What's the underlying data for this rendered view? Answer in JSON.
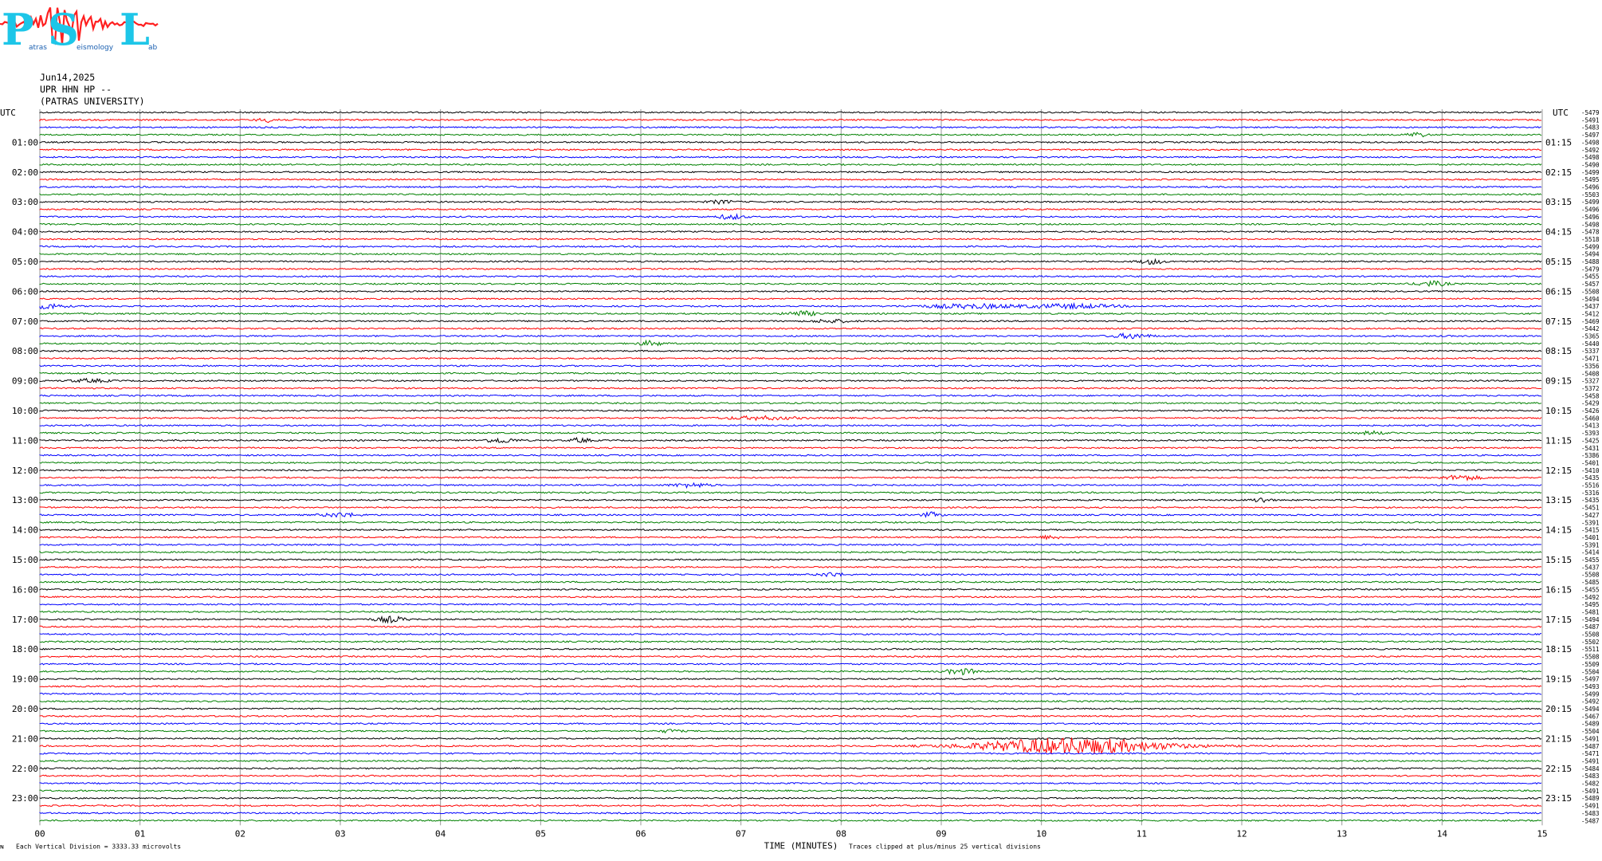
{
  "logo": {
    "letters": [
      "P",
      "S",
      "L"
    ],
    "words": [
      "atras",
      "eismology",
      "ab"
    ],
    "colors": {
      "letters": "#1dc6e8",
      "wave": "#ff2020",
      "words": "#1a5fb0"
    }
  },
  "header": {
    "date": "Jun14,2025",
    "station": "UPR HHN HP --",
    "institution": "(PATRAS UNIVERSITY)"
  },
  "footer": {
    "left_mark": "ɴ",
    "division_note": "Each Vertical Division = 3333.33 microvolts",
    "clip_note": "Traces clipped at plus/minus 25 vertical divisions"
  },
  "chart_data": {
    "type": "line",
    "title": "",
    "xlabel": "TIME (MINUTES)",
    "x_ticks": [
      "00",
      "01",
      "02",
      "03",
      "04",
      "05",
      "06",
      "07",
      "08",
      "09",
      "10",
      "11",
      "12",
      "13",
      "14",
      "15"
    ],
    "xlim": [
      0,
      15
    ],
    "left_axis_title": "UTC",
    "right_axis_title": "UTC",
    "left_hour_labels": [
      "01:00",
      "02:00",
      "03:00",
      "04:00",
      "05:00",
      "06:00",
      "07:00",
      "08:00",
      "09:00",
      "10:00",
      "11:00",
      "12:00",
      "13:00",
      "14:00",
      "15:00",
      "16:00",
      "17:00",
      "18:00",
      "19:00",
      "20:00",
      "21:00",
      "22:00",
      "23:00"
    ],
    "right_hour_labels": [
      "01:15",
      "02:15",
      "03:15",
      "04:15",
      "05:15",
      "06:15",
      "07:15",
      "08:15",
      "09:15",
      "10:15",
      "11:15",
      "12:15",
      "13:15",
      "14:15",
      "15:15",
      "16:15",
      "17:15",
      "18:15",
      "19:15",
      "20:15",
      "21:15",
      "22:15",
      "23:15"
    ],
    "trace_minutes": 15,
    "trace_count": 96,
    "color_cycle": [
      "#000000",
      "#ff0000",
      "#0000ff",
      "#008000"
    ],
    "trace_offsets": [
      "-5479",
      "-5491",
      "-5483",
      "-5497",
      "-5498",
      "-5492",
      "-5498",
      "-5490",
      "-5499",
      "-5495",
      "-5496",
      "-5503",
      "-5499",
      "-5496",
      "-5496",
      "-5498",
      "-5478",
      "-5518",
      "-5499",
      "-5494",
      "-5488",
      "-5479",
      "-5455",
      "-5457",
      "-5508",
      "-5494",
      "-5437",
      "-5412",
      "-5469",
      "-5442",
      "-5365",
      "-5440",
      "-5337",
      "-5471",
      "-5356",
      "-5408",
      "-5327",
      "-5372",
      "-5458",
      "-5429",
      "-5426",
      "-5460",
      "-5413",
      "-5393",
      "-5425",
      "-5431",
      "-5386",
      "-5401",
      "-5410",
      "-5435",
      "-5516",
      "-5316",
      "-5435",
      "-5451",
      "-5427",
      "-5391",
      "-5415",
      "-5401",
      "-5391",
      "-5414",
      "-5455",
      "-5437",
      "-5508",
      "-5485",
      "-5455",
      "-5492",
      "-5495",
      "-5481",
      "-5494",
      "-5487",
      "-5508",
      "-5502",
      "-5511",
      "-5508",
      "-5509",
      "-5504",
      "-5497",
      "-5493",
      "-5499",
      "-5492",
      "-5494",
      "-5467",
      "-5489",
      "-5504",
      "-5491",
      "-5487",
      "-5471",
      "-5491",
      "-5484",
      "-5483",
      "-5482",
      "-5491",
      "-5489",
      "-5491",
      "-5483",
      "-5487"
    ],
    "events": [
      {
        "trace": 1,
        "minute": 2.3,
        "width": 0.2,
        "amp": 2.5
      },
      {
        "trace": 3,
        "minute": 13.75,
        "width": 0.15,
        "amp": 3
      },
      {
        "trace": 12,
        "minute": 6.8,
        "width": 0.2,
        "amp": 2
      },
      {
        "trace": 14,
        "minute": 6.9,
        "width": 0.2,
        "amp": 3
      },
      {
        "trace": 20,
        "minute": 11.1,
        "width": 0.2,
        "amp": 3
      },
      {
        "trace": 23,
        "minute": 13.9,
        "width": 0.25,
        "amp": 3
      },
      {
        "trace": 26,
        "minute": 0.1,
        "width": 0.25,
        "amp": 3
      },
      {
        "trace": 26,
        "minute": 9.3,
        "width": 0.8,
        "amp": 2.5
      },
      {
        "trace": 26,
        "minute": 10.3,
        "width": 0.7,
        "amp": 2.5
      },
      {
        "trace": 27,
        "minute": 7.6,
        "width": 0.25,
        "amp": 3
      },
      {
        "trace": 28,
        "minute": 7.9,
        "width": 0.3,
        "amp": 2
      },
      {
        "trace": 30,
        "minute": 10.9,
        "width": 0.3,
        "amp": 3
      },
      {
        "trace": 31,
        "minute": 6.1,
        "width": 0.2,
        "amp": 3
      },
      {
        "trace": 36,
        "minute": 0.5,
        "width": 0.3,
        "amp": 2
      },
      {
        "trace": 41,
        "minute": 7.2,
        "width": 0.6,
        "amp": 2
      },
      {
        "trace": 43,
        "minute": 13.3,
        "width": 0.2,
        "amp": 2
      },
      {
        "trace": 44,
        "minute": 4.6,
        "width": 0.25,
        "amp": 3
      },
      {
        "trace": 44,
        "minute": 5.4,
        "width": 0.15,
        "amp": 3
      },
      {
        "trace": 49,
        "minute": 14.2,
        "width": 0.3,
        "amp": 3
      },
      {
        "trace": 50,
        "minute": 6.5,
        "width": 0.3,
        "amp": 2.5
      },
      {
        "trace": 52,
        "minute": 12.2,
        "width": 0.15,
        "amp": 3
      },
      {
        "trace": 54,
        "minute": 3.0,
        "width": 0.3,
        "amp": 2.5
      },
      {
        "trace": 54,
        "minute": 8.9,
        "width": 0.15,
        "amp": 3
      },
      {
        "trace": 57,
        "minute": 10.1,
        "width": 0.2,
        "amp": 2
      },
      {
        "trace": 62,
        "minute": 7.9,
        "width": 0.2,
        "amp": 2.5
      },
      {
        "trace": 68,
        "minute": 3.5,
        "width": 0.25,
        "amp": 3.5
      },
      {
        "trace": 75,
        "minute": 9.2,
        "width": 0.25,
        "amp": 3.5
      },
      {
        "trace": 83,
        "minute": 6.3,
        "width": 0.15,
        "amp": 2
      },
      {
        "trace": 85,
        "minute": 10.3,
        "width": 1.5,
        "amp": 10
      }
    ]
  }
}
